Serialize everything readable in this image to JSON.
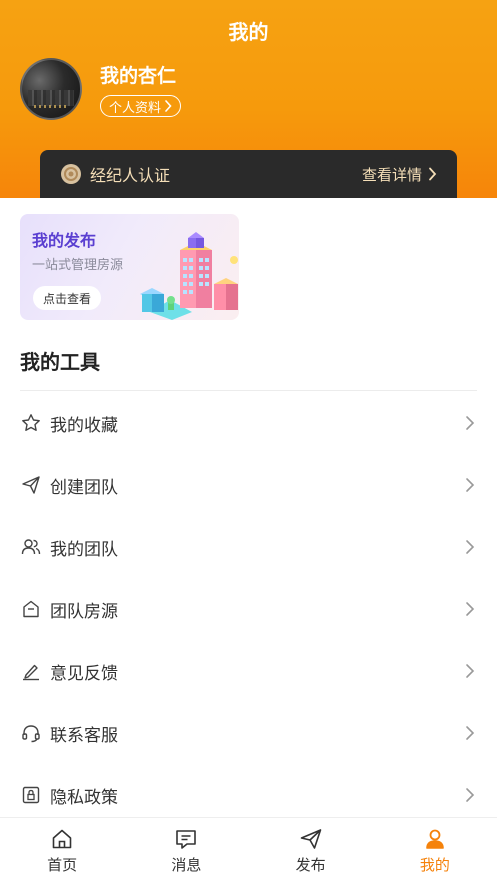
{
  "header": {
    "title": "我的",
    "username": "我的杏仁",
    "profile_link": "个人资料"
  },
  "agent_cert": {
    "label": "经纪人认证",
    "action": "查看详情"
  },
  "promo": {
    "title": "我的发布",
    "subtitle": "一站式管理房源",
    "button": "点击查看"
  },
  "tools": {
    "title": "我的工具",
    "items": [
      {
        "label": "我的收藏",
        "icon": "star-icon"
      },
      {
        "label": "创建团队",
        "icon": "paper-plane-icon"
      },
      {
        "label": "我的团队",
        "icon": "users-icon"
      },
      {
        "label": "团队房源",
        "icon": "house-icon"
      },
      {
        "label": "意见反馈",
        "icon": "edit-pen-icon"
      },
      {
        "label": "联系客服",
        "icon": "headset-icon"
      },
      {
        "label": "隐私政策",
        "icon": "lock-icon"
      }
    ]
  },
  "tabbar": {
    "items": [
      {
        "label": "首页",
        "icon": "home-icon",
        "active": false
      },
      {
        "label": "消息",
        "icon": "message-icon",
        "active": false
      },
      {
        "label": "发布",
        "icon": "send-icon",
        "active": false
      },
      {
        "label": "我的",
        "icon": "user-icon",
        "active": true
      }
    ]
  },
  "colors": {
    "header_top": "#f6a212",
    "header_bottom": "#f6850a",
    "accent": "#f5820b",
    "agent_bar": "#2a2a2a",
    "agent_text": "#f5dfb8"
  }
}
